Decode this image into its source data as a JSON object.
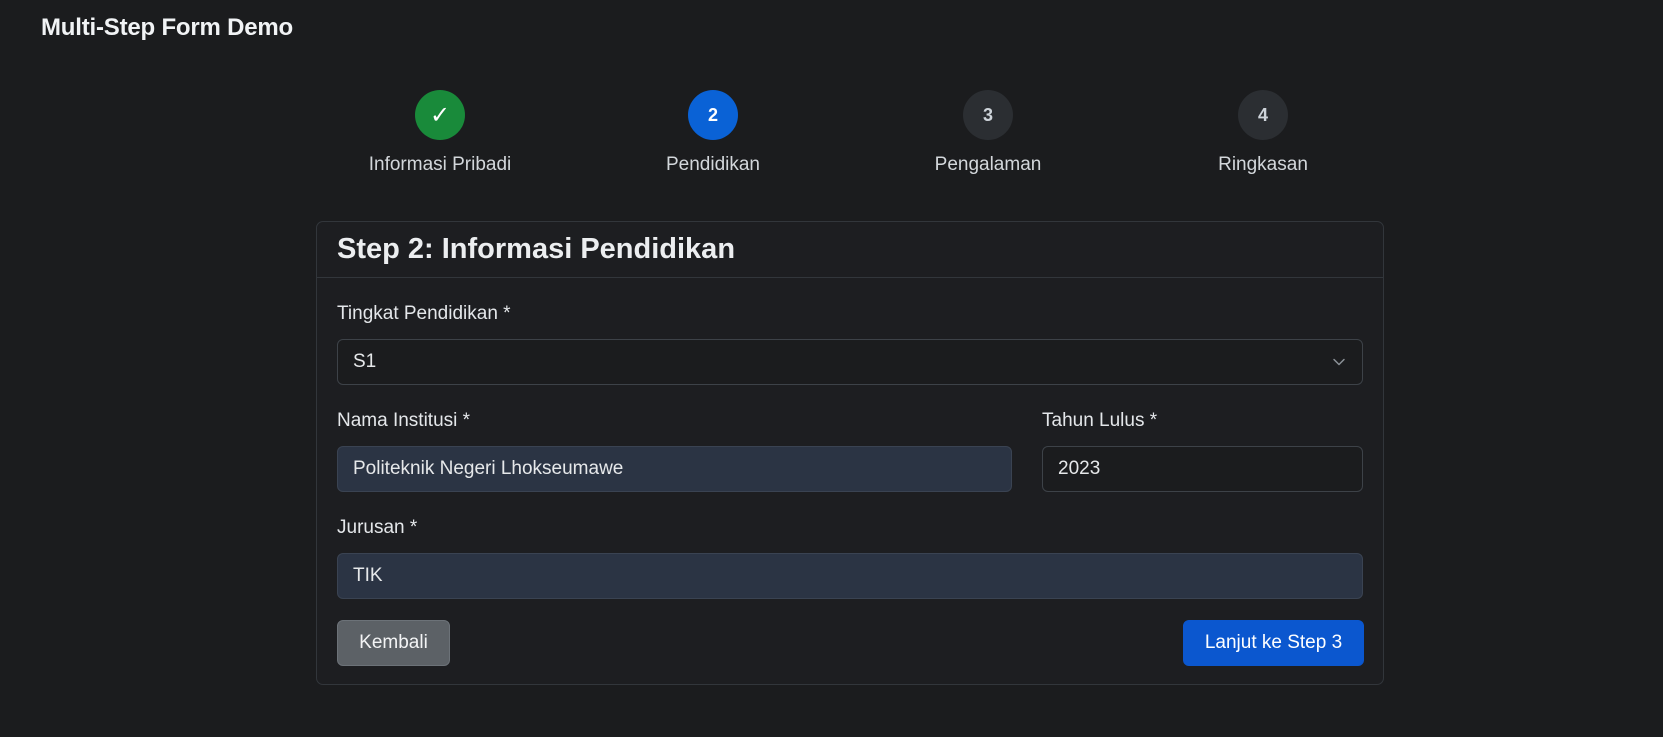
{
  "app": {
    "title": "Multi-Step Form Demo"
  },
  "stepper": {
    "steps": [
      {
        "number": "✓",
        "label": "Informasi Pribadi",
        "status": "completed"
      },
      {
        "number": "2",
        "label": "Pendidikan",
        "status": "active"
      },
      {
        "number": "3",
        "label": "Pengalaman",
        "status": "pending"
      },
      {
        "number": "4",
        "label": "Ringkasan",
        "status": "pending"
      }
    ]
  },
  "form": {
    "title": "Step 2: Informasi Pendidikan",
    "education_level": {
      "label": "Tingkat Pendidikan *",
      "value": "S1"
    },
    "institution": {
      "label": "Nama Institusi *",
      "value": "Politeknik Negeri Lhokseumawe"
    },
    "graduation_year": {
      "label": "Tahun Lulus *",
      "value": "2023"
    },
    "major": {
      "label": "Jurusan *",
      "value": "TIK"
    },
    "back_label": "Kembali",
    "next_label": "Lanjut ke Step 3"
  },
  "colors": {
    "background": "#1b1c1e",
    "completed": "#198a3a",
    "active": "#0a62d6",
    "primary_button": "#0b57cf",
    "secondary_button": "#5c6166"
  }
}
